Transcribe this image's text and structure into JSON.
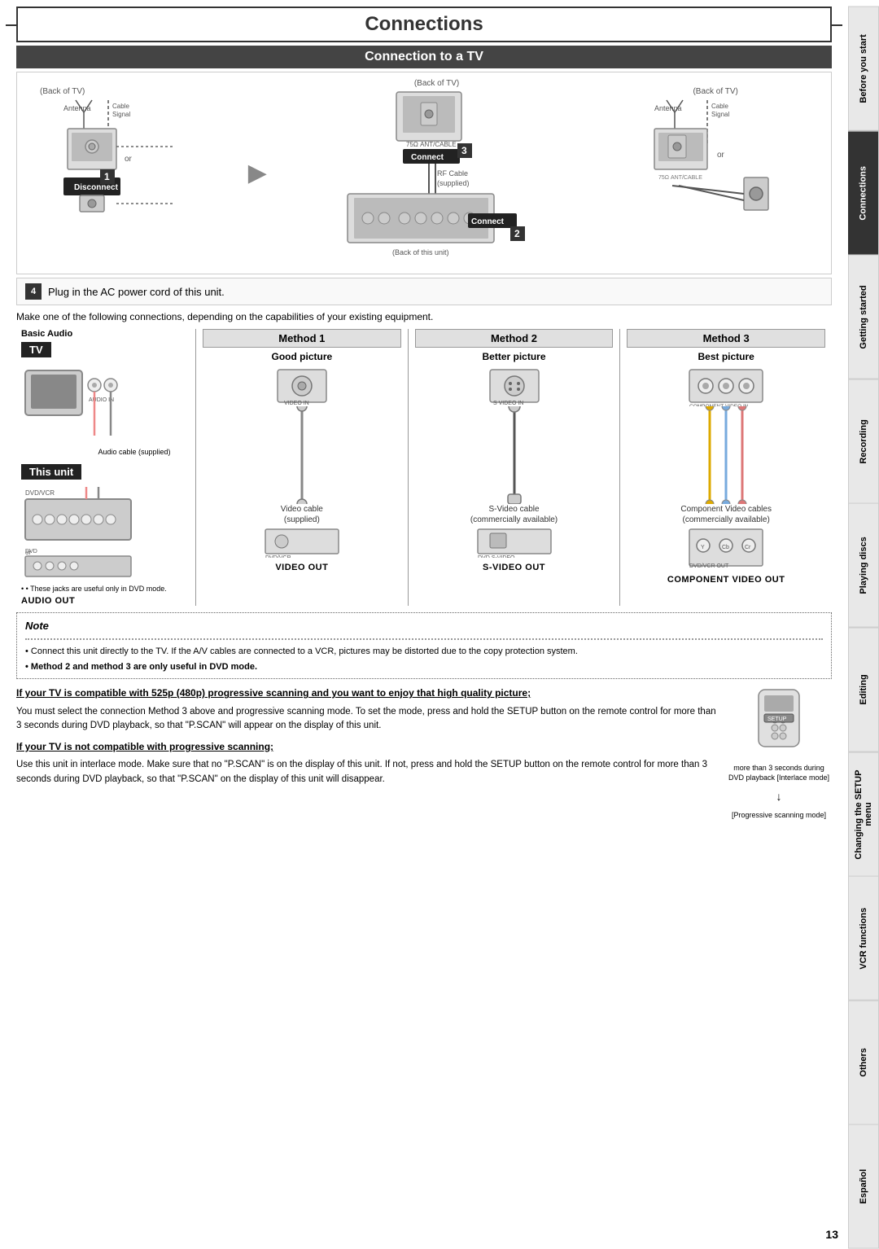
{
  "page": {
    "title": "Connections",
    "page_number": "13"
  },
  "sidebar": {
    "tabs": [
      {
        "label": "Before you start",
        "active": false
      },
      {
        "label": "Connections",
        "active": true
      },
      {
        "label": "Getting started",
        "active": false
      },
      {
        "label": "Recording",
        "active": false
      },
      {
        "label": "Playing discs",
        "active": false
      },
      {
        "label": "Editing",
        "active": false
      },
      {
        "label": "Changing the SETUP menu",
        "active": false
      },
      {
        "label": "VCR functions",
        "active": false
      },
      {
        "label": "Others",
        "active": false
      },
      {
        "label": "Español",
        "active": false
      }
    ]
  },
  "sections": {
    "connection_to_tv": {
      "title": "Connection to a TV",
      "step1_label": "Disconnect",
      "step2_label": "Connect",
      "step3_label": "Connect",
      "step1_number": "1",
      "step2_number": "2",
      "step3_number": "3",
      "antenna_label": "Antenna",
      "cable_signal_label": "Cable Signal",
      "back_of_tv_label": "(Back of TV)",
      "back_of_this_unit_label": "(Back of this unit)",
      "rf_cable_label": "RF Cable (supplied)",
      "or_label": "or",
      "step4_text": "Plug in the AC power cord of this unit.",
      "step4_number": "4"
    },
    "intro_text": "Make one of the following connections, depending on the capabilities of your existing equipment.",
    "methods": {
      "method1": {
        "header": "Method 1",
        "quality": "Good picture",
        "port": "VIDEO OUT",
        "cable_name": "Video cable",
        "cable_note": "(supplied)"
      },
      "method2": {
        "header": "Method 2",
        "quality": "Better picture",
        "port": "S-VIDEO OUT",
        "cable_name": "S-Video cable",
        "cable_note": "(commercially available)"
      },
      "method3": {
        "header": "Method 3",
        "quality": "Best picture",
        "port": "COMPONENT VIDEO OUT",
        "cable_name": "Component Video cables",
        "cable_note": "(commercially available)"
      }
    },
    "basic_audio": {
      "label": "Basic Audio",
      "tv_label": "TV",
      "this_unit_label": "This unit",
      "audio_cable_note": "Audio cable (supplied)",
      "audio_out_label": "AUDIO OUT",
      "jacks_note": "• These jacks are useful only in DVD mode."
    }
  },
  "note_section": {
    "title": "Note",
    "bullets": [
      "Connect this unit directly to the TV. If the A/V cables are connected to a VCR, pictures may be distorted due to the copy protection system.",
      "Method 2 and method 3 are only useful in DVD mode."
    ],
    "bullet2_bold": true
  },
  "progressive_section": {
    "heading1": "If your TV is compatible with 525p (480p) progressive scanning and you want to enjoy that high quality picture;",
    "text1": "You must select the connection Method 3 above and progressive scanning mode. To set the mode, press and hold the SETUP button on the remote control for more than 3 seconds during DVD playback, so that \"P.SCAN\" will appear on the display of this unit.",
    "heading2": "If your TV is not compatible with progressive scanning;",
    "text2": "Use this unit in interlace mode. Make sure that no \"P.SCAN\" is on the display of this unit. If not, press and hold the SETUP button on the remote control for more than 3 seconds during DVD playback, so that \"P.SCAN\" on the display of this unit will disappear.",
    "caption1": "more than 3 seconds during DVD playback [Interlace mode]",
    "caption2": "[Progressive scanning mode]",
    "arrow_label": "↓"
  }
}
